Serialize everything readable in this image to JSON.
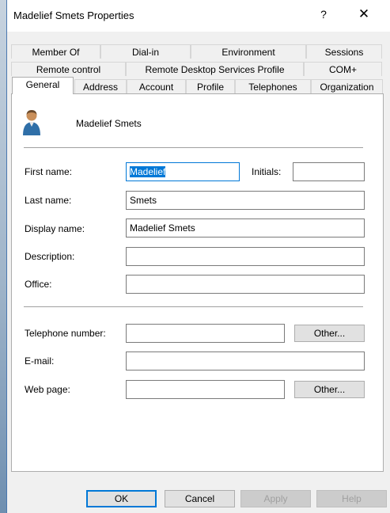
{
  "window": {
    "title": "Madelief Smets Properties",
    "help_glyph": "?",
    "close_glyph": "✕"
  },
  "tabs": {
    "row1": [
      "Member Of",
      "Dial-in",
      "Environment",
      "Sessions"
    ],
    "row2": [
      "Remote control",
      "Remote Desktop Services Profile",
      "COM+"
    ],
    "row3": [
      "General",
      "Address",
      "Account",
      "Profile",
      "Telephones",
      "Organization"
    ],
    "selected": "General"
  },
  "general": {
    "display_header": "Madelief Smets",
    "labels": {
      "first_name": "First name:",
      "initials": "Initials:",
      "last_name": "Last name:",
      "display_name": "Display name:",
      "description": "Description:",
      "office": "Office:",
      "telephone": "Telephone number:",
      "email": "E-mail:",
      "web_page": "Web page:"
    },
    "values": {
      "first_name": "Madelief",
      "initials": "",
      "last_name": "Smets",
      "display_name": "Madelief Smets",
      "description": "",
      "office": "",
      "telephone": "",
      "email": "",
      "web_page": ""
    },
    "other_label": "Other..."
  },
  "buttons": {
    "ok": "OK",
    "cancel": "Cancel",
    "apply": "Apply",
    "help": "Help"
  },
  "colors": {
    "accent": "#0078d7",
    "dialog_bg": "#f0f0f0",
    "desktop": "#5b7fa6"
  },
  "icons": {
    "user": "user-icon"
  }
}
